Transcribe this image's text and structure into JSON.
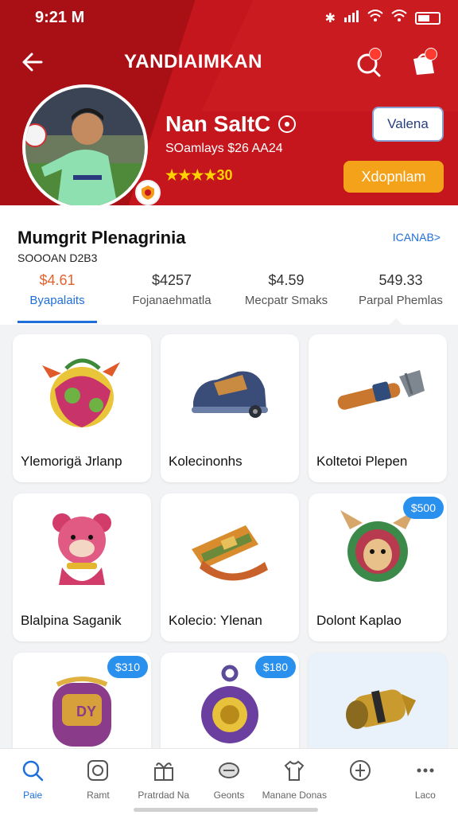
{
  "status": {
    "time": "9:21 M"
  },
  "header": {
    "title": "YANDIAIMKAN",
    "search_badge": "",
    "bag_badge": ""
  },
  "profile": {
    "name": "Nan SaItC",
    "meta": "SOamlays  $26 AA24",
    "rating": "★★★★30",
    "follow_label": "Valena",
    "primary_label": "Xdopnlam"
  },
  "panel": {
    "title": "Mumgrit Plenagrinia",
    "subtitle": "SOOOAN D2B3",
    "link": "ICANAB>",
    "stats": [
      {
        "value": "$4.61",
        "label": "Byapalaits"
      },
      {
        "value": "$4257",
        "label": "Fojanaehmatla"
      },
      {
        "value": "$4.59",
        "label": "Mecpatr Smaks"
      },
      {
        "value": "549.33",
        "label": "Parpal Phemlas"
      }
    ]
  },
  "items": [
    {
      "name": "Ylemorigä Jrlanp",
      "price": ""
    },
    {
      "name": "Kolecinonhs",
      "price": ""
    },
    {
      "name": "Koltetoi Plepen",
      "price": ""
    },
    {
      "name": "Blalpina Saganik",
      "price": ""
    },
    {
      "name": "Kolecio: Ylenan",
      "price": ""
    },
    {
      "name": "Dolont Kaplao",
      "price": "$500"
    },
    {
      "name": "",
      "price": "$310"
    },
    {
      "name": "",
      "price": "$180"
    },
    {
      "name": "",
      "price": ""
    }
  ],
  "nav": [
    {
      "label": "Paie",
      "icon": "search-icon"
    },
    {
      "label": "Ramt",
      "icon": "camera-icon"
    },
    {
      "label": "Pratrdad Na",
      "icon": "gift-icon"
    },
    {
      "label": "Geonts",
      "icon": "chat-icon"
    },
    {
      "label": "Manane Donas",
      "icon": "shirt-icon"
    },
    {
      "label": "",
      "icon": "compass-icon"
    },
    {
      "label": "Laco",
      "icon": "more-icon"
    }
  ]
}
